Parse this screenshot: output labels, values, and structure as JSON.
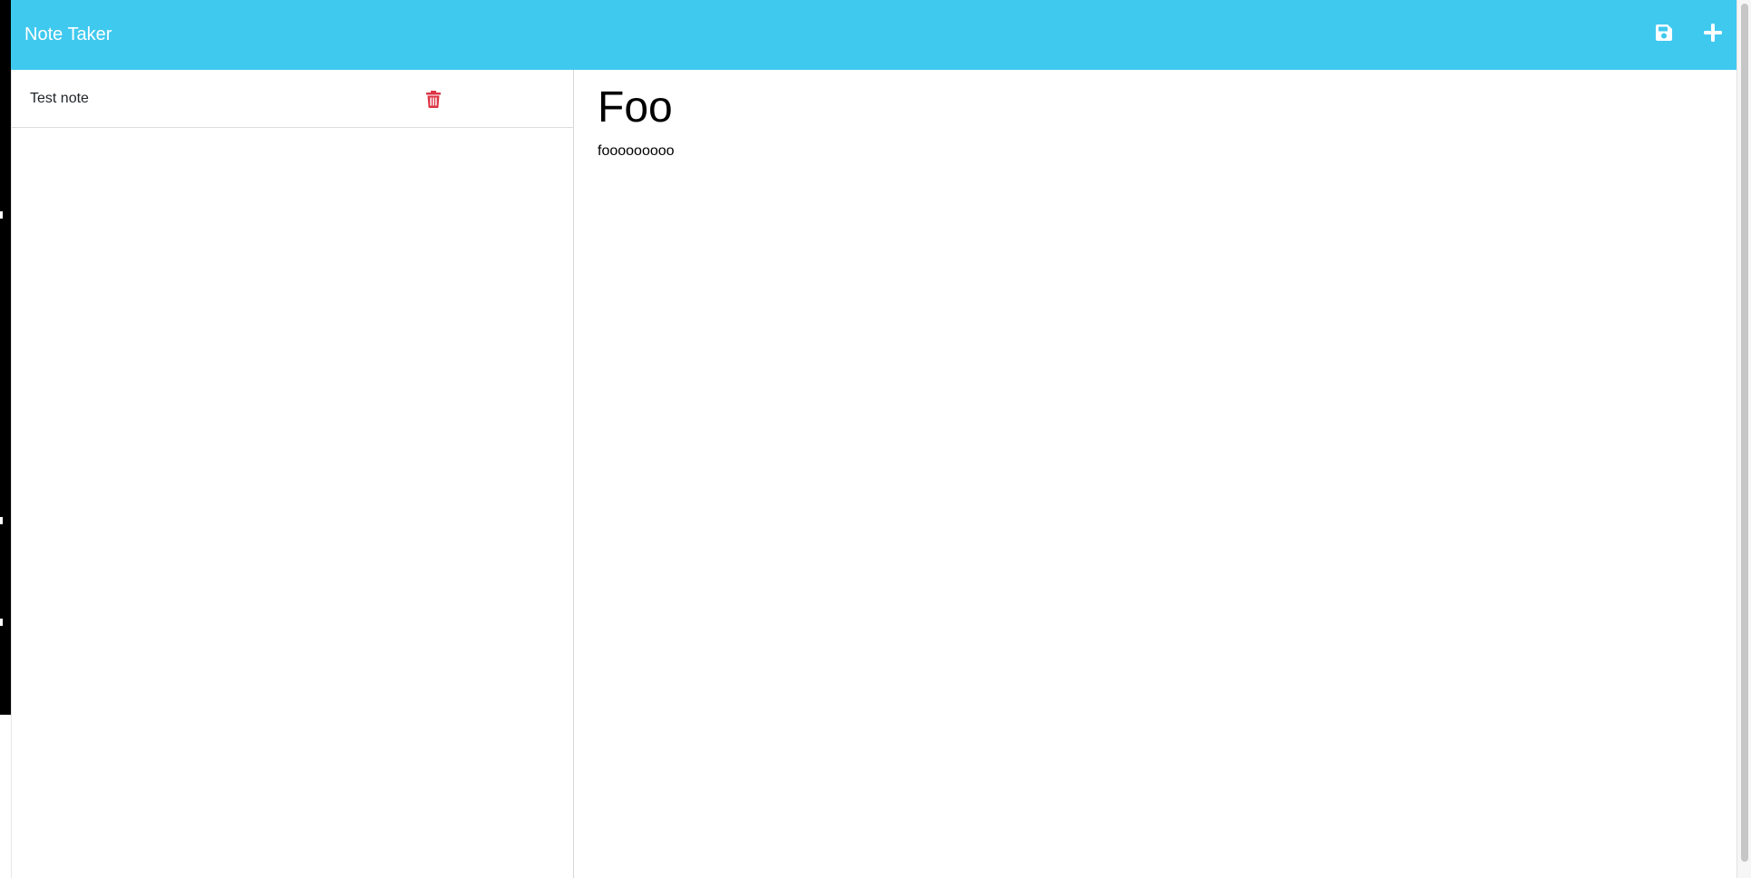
{
  "navbar": {
    "brand": "Note Taker",
    "save_icon": "save-icon",
    "new_icon": "plus-icon",
    "background": "#40c9ef"
  },
  "sidebar": {
    "notes": [
      {
        "title": "Test note",
        "delete_icon": "trash-icon",
        "delete_color": "#dc3545"
      }
    ]
  },
  "editor": {
    "title": "Foo",
    "text": "fooooooooo"
  }
}
